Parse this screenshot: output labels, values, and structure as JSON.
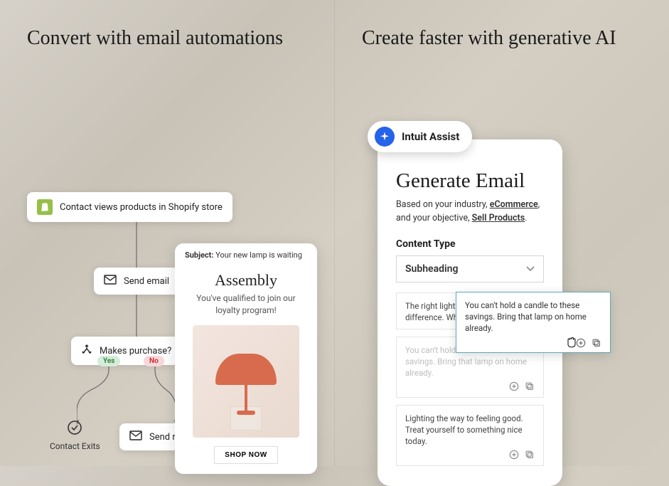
{
  "left": {
    "heading": "Convert with email automations",
    "nodes": {
      "trigger": "Contact views products in Shopify store",
      "send": "Send email",
      "decision": "Makes purchase?",
      "reminder": "Send reminder"
    },
    "branches": {
      "yes": "Yes",
      "no": "No"
    },
    "exit": "Contact Exits",
    "email": {
      "subject_label": "Subject:",
      "subject_value": "Your new lamp is waiting",
      "brand": "Assembly",
      "copy": "You've qualified to join our loyalty program!",
      "cta": "SHOP NOW"
    }
  },
  "right": {
    "heading": "Create faster with generative AI",
    "assist": "Intuit Assist",
    "gen_title": "Generate Email",
    "sub_pre": "Based on your industry, ",
    "sub_industry": "eCommerce",
    "sub_mid": ", and your objective, ",
    "sub_objective": "Sell Products",
    "sub_post": ".",
    "content_type_label": "Content Type",
    "content_type_value": "Subheading",
    "suggestions": [
      "The right light really makes a difference. Why not mak",
      "You can't hold a candle to these savings. Bring that lamp on home already.",
      "Lighting the way to feeling good. Treat yourself to something nice today."
    ],
    "tooltip": "You can't hold a candle to these savings. Bring that lamp on home already."
  }
}
